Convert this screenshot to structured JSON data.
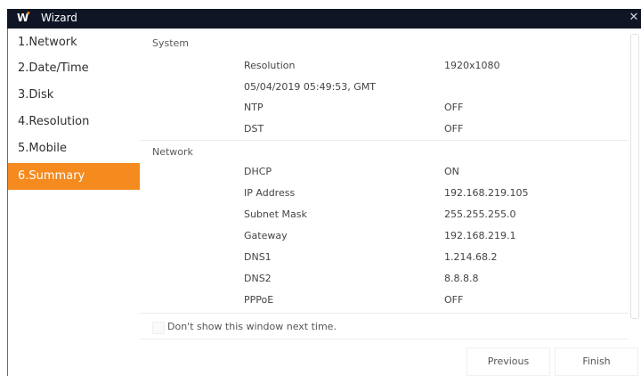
{
  "window": {
    "title": "Wizard",
    "logo_text": "W",
    "close_glyph": "✕"
  },
  "sidebar": {
    "items": [
      {
        "label": "1.Network"
      },
      {
        "label": "2.Date/Time"
      },
      {
        "label": "3.Disk"
      },
      {
        "label": "4.Resolution"
      },
      {
        "label": "5.Mobile"
      },
      {
        "label": "6.Summary",
        "active": true
      }
    ]
  },
  "sections": {
    "system": {
      "title": "System",
      "rows": [
        {
          "key": "Resolution",
          "value": "1920x1080"
        },
        {
          "key": "05/04/2019 05:49:53, GMT",
          "value": ""
        },
        {
          "key": "NTP",
          "value": "OFF"
        },
        {
          "key": "DST",
          "value": "OFF"
        }
      ]
    },
    "network": {
      "title": "Network",
      "rows": [
        {
          "key": "DHCP",
          "value": "ON"
        },
        {
          "key": "IP Address",
          "value": "192.168.219.105"
        },
        {
          "key": "Subnet Mask",
          "value": "255.255.255.0"
        },
        {
          "key": "Gateway",
          "value": "192.168.219.1"
        },
        {
          "key": "DNS1",
          "value": "1.214.68.2"
        },
        {
          "key": "DNS2",
          "value": "8.8.8.8"
        },
        {
          "key": "PPPoE",
          "value": "OFF"
        }
      ]
    }
  },
  "footer": {
    "dont_show_label": "Don't show this window next time.",
    "previous_label": "Previous",
    "finish_label": "Finish"
  },
  "colors": {
    "accent": "#f58a1f",
    "titlebar": "#0f1524"
  }
}
